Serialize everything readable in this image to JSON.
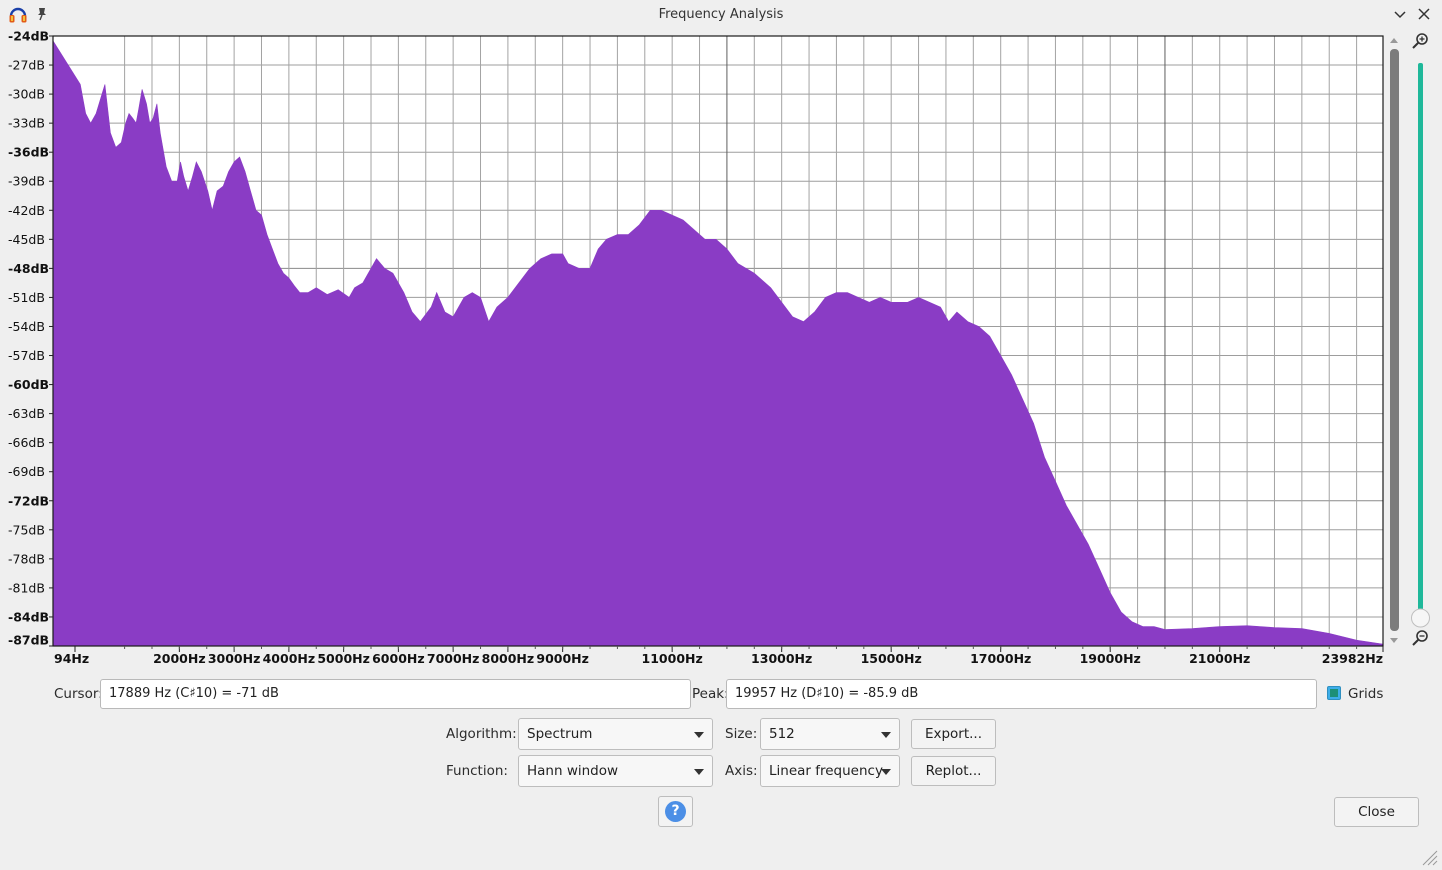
{
  "window": {
    "title": "Frequency Analysis"
  },
  "icons": {
    "app": "audacity-headphones-icon",
    "pin": "pin-icon",
    "minimize": "chevron-down-icon",
    "close": "close-icon",
    "zoom_in": "zoom-in-icon",
    "zoom_out": "zoom-out-icon",
    "help": "help-icon",
    "resize": "resize-grip-icon"
  },
  "colors": {
    "spectrum_fill": "#8a3cc5",
    "zoom_slider": "#1fb89a",
    "scrollbar": "#7c7c7c"
  },
  "chart_data": {
    "type": "area",
    "y_ticks": [
      "-24dB",
      "-27dB",
      "-30dB",
      "-33dB",
      "-36dB",
      "-39dB",
      "-42dB",
      "-45dB",
      "-48dB",
      "-51dB",
      "-54dB",
      "-57dB",
      "-60dB",
      "-63dB",
      "-66dB",
      "-69dB",
      "-72dB",
      "-75dB",
      "-78dB",
      "-81dB",
      "-84dB",
      "-87dB"
    ],
    "y_bold": [
      "-24dB",
      "-36dB",
      "-48dB",
      "-60dB",
      "-72dB",
      "-84dB",
      "-87dB"
    ],
    "x_ticks": [
      {
        "label": "94Hz",
        "hz": 94
      },
      {
        "label": "2000Hz",
        "hz": 2000
      },
      {
        "label": "3000Hz",
        "hz": 3000
      },
      {
        "label": "4000Hz",
        "hz": 4000
      },
      {
        "label": "5000Hz",
        "hz": 5000
      },
      {
        "label": "6000Hz",
        "hz": 6000
      },
      {
        "label": "7000Hz",
        "hz": 7000
      },
      {
        "label": "8000Hz",
        "hz": 8000
      },
      {
        "label": "9000Hz",
        "hz": 9000
      },
      {
        "label": "11000Hz",
        "hz": 11000
      },
      {
        "label": "13000Hz",
        "hz": 13000
      },
      {
        "label": "15000Hz",
        "hz": 15000
      },
      {
        "label": "17000Hz",
        "hz": 17000
      },
      {
        "label": "19000Hz",
        "hz": 19000
      },
      {
        "label": "21000Hz",
        "hz": 21000
      },
      {
        "label": "23982Hz",
        "hz": 23982
      }
    ],
    "xlim": [
      94,
      23982
    ],
    "ylim": [
      -87,
      -24
    ],
    "grid": true,
    "points": [
      [
        94,
        -24.5
      ],
      [
        190,
        -29
      ],
      [
        290,
        -32
      ],
      [
        380,
        -33
      ],
      [
        480,
        -32
      ],
      [
        560,
        -30.5
      ],
      [
        640,
        -29
      ],
      [
        740,
        -34
      ],
      [
        840,
        -35.5
      ],
      [
        940,
        -35
      ],
      [
        1020,
        -33
      ],
      [
        1080,
        -32
      ],
      [
        1150,
        -32.5
      ],
      [
        1210,
        -33
      ],
      [
        1260,
        -31.5
      ],
      [
        1320,
        -29.5
      ],
      [
        1400,
        -31
      ],
      [
        1460,
        -33
      ],
      [
        1520,
        -32.5
      ],
      [
        1590,
        -31
      ],
      [
        1650,
        -34
      ],
      [
        1760,
        -37.5
      ],
      [
        1860,
        -39
      ],
      [
        1960,
        -39
      ],
      [
        2020,
        -37
      ],
      [
        2080,
        -38.5
      ],
      [
        2160,
        -40
      ],
      [
        2240,
        -38.5
      ],
      [
        2310,
        -37
      ],
      [
        2400,
        -38
      ],
      [
        2520,
        -40
      ],
      [
        2600,
        -42
      ],
      [
        2690,
        -40
      ],
      [
        2800,
        -39.5
      ],
      [
        2900,
        -38
      ],
      [
        3000,
        -37
      ],
      [
        3100,
        -36.5
      ],
      [
        3200,
        -38
      ],
      [
        3300,
        -40
      ],
      [
        3400,
        -42
      ],
      [
        3500,
        -42.5
      ],
      [
        3600,
        -44.5
      ],
      [
        3700,
        -46
      ],
      [
        3800,
        -47.5
      ],
      [
        3900,
        -48.5
      ],
      [
        4000,
        -49
      ],
      [
        4100,
        -49.8
      ],
      [
        4200,
        -50.5
      ],
      [
        4350,
        -50.5
      ],
      [
        4500,
        -50
      ],
      [
        4700,
        -50.7
      ],
      [
        4900,
        -50.2
      ],
      [
        5100,
        -51
      ],
      [
        5200,
        -50
      ],
      [
        5350,
        -49.5
      ],
      [
        5500,
        -48
      ],
      [
        5600,
        -47
      ],
      [
        5750,
        -48
      ],
      [
        5900,
        -48.5
      ],
      [
        6100,
        -50.5
      ],
      [
        6250,
        -52.5
      ],
      [
        6400,
        -53.5
      ],
      [
        6600,
        -52
      ],
      [
        6700,
        -50.5
      ],
      [
        6850,
        -52.5
      ],
      [
        7000,
        -53
      ],
      [
        7200,
        -51
      ],
      [
        7350,
        -50.5
      ],
      [
        7500,
        -51
      ],
      [
        7650,
        -53.5
      ],
      [
        7800,
        -52
      ],
      [
        8000,
        -51
      ],
      [
        8200,
        -49.5
      ],
      [
        8400,
        -48
      ],
      [
        8600,
        -47
      ],
      [
        8800,
        -46.5
      ],
      [
        9000,
        -46.5
      ],
      [
        9100,
        -47.5
      ],
      [
        9300,
        -48
      ],
      [
        9500,
        -48
      ],
      [
        9650,
        -46
      ],
      [
        9800,
        -45
      ],
      [
        10000,
        -44.5
      ],
      [
        10200,
        -44.5
      ],
      [
        10400,
        -43.5
      ],
      [
        10600,
        -42
      ],
      [
        10800,
        -42
      ],
      [
        11000,
        -42.5
      ],
      [
        11200,
        -43
      ],
      [
        11400,
        -44
      ],
      [
        11600,
        -45
      ],
      [
        11800,
        -45
      ],
      [
        12000,
        -46
      ],
      [
        12200,
        -47.5
      ],
      [
        12500,
        -48.5
      ],
      [
        12800,
        -50
      ],
      [
        13000,
        -51.5
      ],
      [
        13200,
        -53
      ],
      [
        13400,
        -53.5
      ],
      [
        13600,
        -52.5
      ],
      [
        13800,
        -51
      ],
      [
        14000,
        -50.5
      ],
      [
        14200,
        -50.5
      ],
      [
        14400,
        -51
      ],
      [
        14600,
        -51.5
      ],
      [
        14800,
        -51
      ],
      [
        15000,
        -51.5
      ],
      [
        15300,
        -51.5
      ],
      [
        15500,
        -51
      ],
      [
        15700,
        -51.5
      ],
      [
        15900,
        -52
      ],
      [
        16050,
        -53.5
      ],
      [
        16200,
        -52.5
      ],
      [
        16400,
        -53.5
      ],
      [
        16600,
        -54
      ],
      [
        16800,
        -55
      ],
      [
        17000,
        -57
      ],
      [
        17200,
        -59
      ],
      [
        17400,
        -61.5
      ],
      [
        17600,
        -64
      ],
      [
        17800,
        -67.5
      ],
      [
        18000,
        -70
      ],
      [
        18200,
        -72.5
      ],
      [
        18400,
        -74.5
      ],
      [
        18600,
        -76.5
      ],
      [
        18800,
        -79
      ],
      [
        19000,
        -81.5
      ],
      [
        19200,
        -83.5
      ],
      [
        19400,
        -84.5
      ],
      [
        19600,
        -85
      ],
      [
        19800,
        -85
      ],
      [
        20000,
        -85.3
      ],
      [
        20500,
        -85.2
      ],
      [
        21000,
        -85
      ],
      [
        21500,
        -84.9
      ],
      [
        22000,
        -85.1
      ],
      [
        22500,
        -85.2
      ],
      [
        23000,
        -85.7
      ],
      [
        23500,
        -86.4
      ],
      [
        23982,
        -86.8
      ]
    ]
  },
  "cursor": {
    "label": "Cursor:",
    "value": "17889 Hz (C♯10) = -71 dB"
  },
  "peak": {
    "label": "Peak:",
    "value": "19957 Hz (D♯10) = -85.9 dB"
  },
  "grids": {
    "label": "Grids",
    "checked": true
  },
  "algorithm": {
    "label": "Algorithm:",
    "value": "Spectrum"
  },
  "size": {
    "label": "Size:",
    "value": "512"
  },
  "function": {
    "label": "Function:",
    "value": "Hann window"
  },
  "axis": {
    "label": "Axis:",
    "value": "Linear frequency"
  },
  "buttons": {
    "export": "Export...",
    "replot": "Replot...",
    "close": "Close"
  },
  "help": {
    "glyph": "?"
  }
}
